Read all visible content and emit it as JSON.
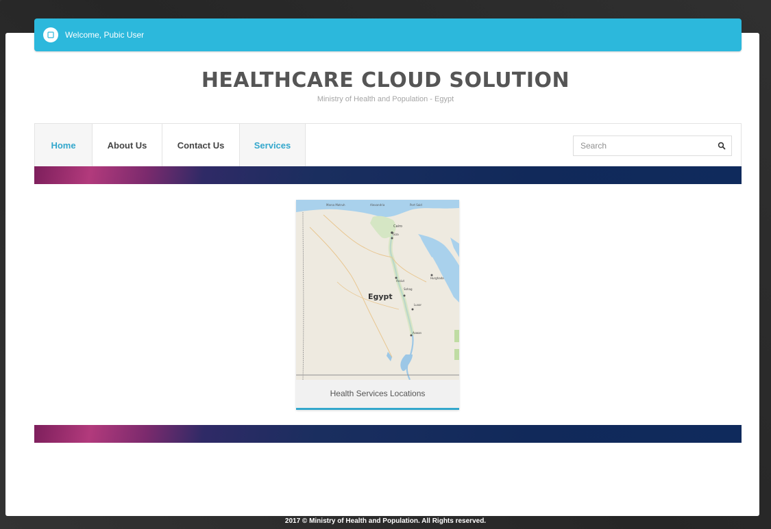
{
  "header": {
    "welcome_text": "Welcome, Pubic User",
    "title": "HEALTHCARE CLOUD SOLUTION",
    "subtitle": "Ministry of Health and Population - Egypt"
  },
  "nav": {
    "items": [
      {
        "label": "Home",
        "active": true
      },
      {
        "label": "About Us",
        "active": false
      },
      {
        "label": "Contact Us",
        "active": false
      },
      {
        "label": "Services",
        "active": true
      }
    ],
    "search": {
      "placeholder": "Search",
      "icon": "search-icon"
    }
  },
  "main": {
    "card": {
      "caption": "Health Services Locations",
      "map": {
        "country_label": "Egypt",
        "city_labels": [
          "Marsa Matruh",
          "Alexandria",
          "Port Said",
          "Cairo",
          "Giza",
          "Assiut",
          "Sohag",
          "Luxor",
          "Aswan",
          "Hurghada"
        ]
      }
    }
  },
  "footer": {
    "text": "2017 © Ministry of Health and Population. All Rights reserved."
  },
  "colors": {
    "accent": "#2cb8dc",
    "link": "#33a7cc",
    "band_dark": "#11295a",
    "band_magenta": "#b23a7c"
  }
}
